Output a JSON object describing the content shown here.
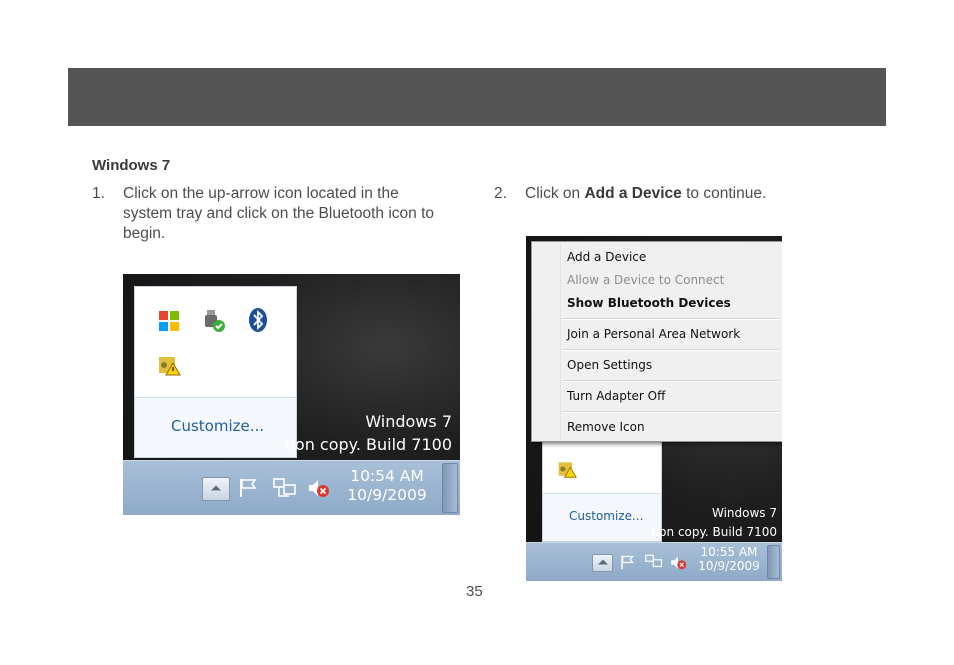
{
  "section_title": "Windows 7",
  "steps": [
    {
      "number": "1.",
      "text": "Click on the up-arrow icon located in the system tray and click on the Bluetooth icon to begin."
    },
    {
      "number": "2.",
      "before": "Click on ",
      "bold": "Add a Device",
      "after": " to continue."
    }
  ],
  "screenshot1": {
    "customize_label": "Customize...",
    "watermark_line1": "Windows 7",
    "watermark_line2": "tion copy. Build 7100",
    "clock_time": "10:54 AM",
    "clock_date": "10/9/2009",
    "icons": [
      "windows-flag-icon",
      "usb-device-icon",
      "bluetooth-icon",
      "security-key-warning-icon",
      "up-arrow-icon",
      "action-center-flag-icon",
      "network-icon",
      "volume-muted-icon"
    ]
  },
  "screenshot2": {
    "menu_items": [
      "Add a Device",
      "Allow a Device to Connect",
      "Show Bluetooth Devices",
      "Join a Personal Area Network",
      "Open Settings",
      "Turn Adapter Off",
      "Remove Icon"
    ],
    "customize_label": "Customize...",
    "watermark_line1": "Windows 7",
    "watermark_line2": "tion copy. Build 7100",
    "clock_time": "10:55 AM",
    "clock_date": "10/9/2009"
  },
  "page_number": "35",
  "colors": {
    "header_bar": "#555555",
    "taskbar": "#9db6d2",
    "link_blue": "#1f5e9e",
    "bluetooth_blue": "#1d4f9c",
    "ok_green": "#3cae3c",
    "mute_red": "#d83a2e"
  }
}
